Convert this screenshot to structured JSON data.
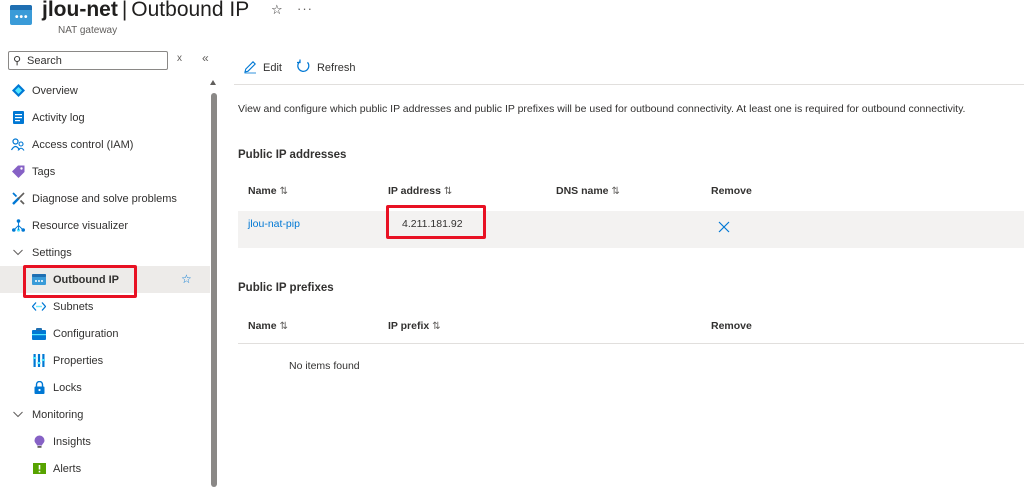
{
  "header": {
    "resource_name": "jlou-net",
    "separator": "|",
    "blade_title": "Outbound IP",
    "subtitle": "NAT gateway",
    "star_glyph": "☆",
    "more_glyph": "···"
  },
  "sidebar": {
    "search_placeholder": "Search",
    "clear_glyph": "x",
    "collapse_glyph": "«",
    "items": [
      {
        "label": "Overview",
        "icon": "overview-icon"
      },
      {
        "label": "Activity log",
        "icon": "activity-log-icon"
      },
      {
        "label": "Access control (IAM)",
        "icon": "iam-icon"
      },
      {
        "label": "Tags",
        "icon": "tag-icon"
      },
      {
        "label": "Diagnose and solve problems",
        "icon": "diagnose-icon"
      },
      {
        "label": "Resource visualizer",
        "icon": "visualizer-icon"
      },
      {
        "label": "Settings",
        "icon": "chevron-down-icon"
      },
      {
        "label": "Outbound IP",
        "icon": "outbound-ip-icon"
      },
      {
        "label": "Subnets",
        "icon": "subnets-icon"
      },
      {
        "label": "Configuration",
        "icon": "configuration-icon"
      },
      {
        "label": "Properties",
        "icon": "properties-icon"
      },
      {
        "label": "Locks",
        "icon": "lock-icon"
      },
      {
        "label": "Monitoring",
        "icon": "chevron-down-icon"
      },
      {
        "label": "Insights",
        "icon": "insights-icon"
      },
      {
        "label": "Alerts",
        "icon": "alerts-icon"
      }
    ],
    "fav_star": "☆"
  },
  "toolbar": {
    "edit_label": "Edit",
    "refresh_label": "Refresh"
  },
  "main": {
    "description": "View and configure which public IP addresses and public IP prefixes will be used for outbound connectivity. At least one is required for outbound connectivity.",
    "public_ip": {
      "title": "Public IP addresses",
      "columns": [
        "Name",
        "IP address",
        "DNS name",
        "Remove"
      ],
      "rows": [
        {
          "name": "jlou-nat-pip",
          "ip": "4.211.181.92",
          "dns": ""
        }
      ]
    },
    "public_prefix": {
      "title": "Public IP prefixes",
      "columns": [
        "Name",
        "IP prefix",
        "Remove"
      ],
      "empty_text": "No items found"
    },
    "sort_glyph": "⇅"
  },
  "colors": {
    "accent": "#0078d4",
    "highlight": "#e81123",
    "active_bg": "#edebe9"
  }
}
